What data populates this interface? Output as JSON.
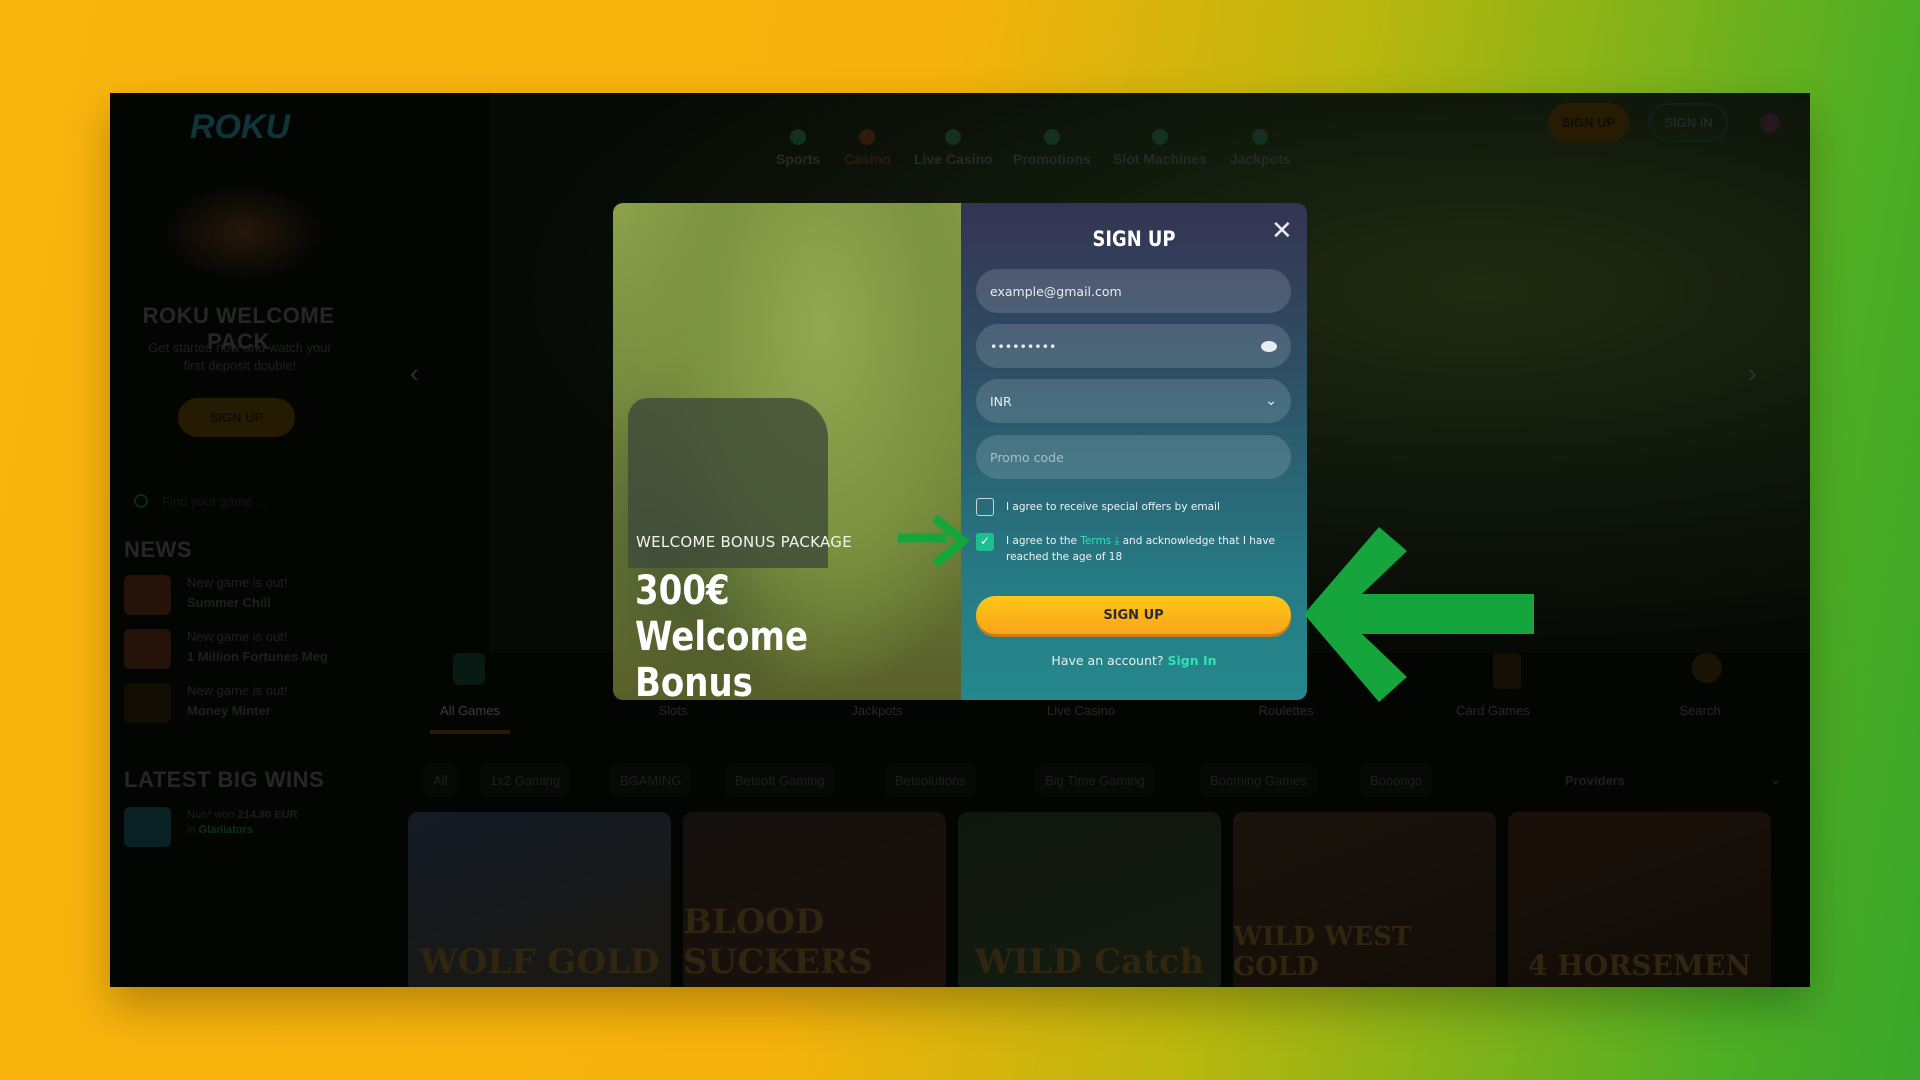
{
  "header": {
    "logo": "ROKU",
    "nav": [
      {
        "label": "Sports",
        "icon": "soccer-ball-icon"
      },
      {
        "label": "Casino",
        "icon": "slot-machine-icon",
        "active": true
      },
      {
        "label": "Live Casino",
        "icon": "dealer-icon"
      },
      {
        "label": "Promotions",
        "icon": "gift-icon"
      },
      {
        "label": "Slot Machines",
        "icon": "slot-icon"
      },
      {
        "label": "Jackpots",
        "icon": "jackpot-icon"
      }
    ],
    "signup": "SIGN UP",
    "signin": "SIGN IN",
    "language": "uk-flag-icon"
  },
  "sidebar": {
    "welcome_title": "ROKU WELCOME PACK",
    "welcome_text": "Get started now and watch your first deposit double!",
    "signup": "SIGN UP",
    "search_placeholder": "Find your game ...",
    "news_title": "NEWS",
    "news": [
      {
        "caption": "New game is out!",
        "game": "Summer Chill"
      },
      {
        "caption": "New game is out!",
        "game": "1 Million Fortunes Meg"
      },
      {
        "caption": "New game is out!",
        "game": "Money Minter"
      }
    ],
    "wins_title": "LATEST BIG WINS",
    "wins": [
      {
        "user": "Nun* won",
        "amount": "214.80 EUR",
        "in": "in",
        "game": "Gladiators"
      }
    ]
  },
  "categories": [
    "All Games",
    "Slots",
    "Jackpots",
    "Live Casino",
    "Roulettes",
    "Card Games",
    "Search"
  ],
  "providers": {
    "items": [
      "All",
      "1x2 Gaming",
      "BGAMING",
      "Betsoft Gaming",
      "Betsolutions",
      "Big Time Gaming",
      "Booming Games",
      "Booongo"
    ],
    "dropdown": "Providers"
  },
  "games": [
    "WOLF GOLD",
    "BLOOD SUCKERS",
    "WILD Catch",
    "WILD WEST GOLD",
    "4 HORSEMEN"
  ],
  "modal": {
    "promo_subtitle": "WELCOME BONUS PACKAGE",
    "promo_title": "300€ Welcome Bonus",
    "title": "SIGN UP",
    "email": "example@gmail.com",
    "password": "•••••••••",
    "currency": "INR",
    "promo_placeholder": "Promo code",
    "offers_label": "I agree to receive special offers by email",
    "offers_checked": false,
    "terms_pre": "I agree to the",
    "terms_link": "Terms",
    "terms_post": "and acknowledge that I have reached the age of 18",
    "terms_checked": true,
    "submit": "SIGN UP",
    "have_account": "Have an account?",
    "signin_link": "Sign In"
  },
  "colors": {
    "accent_yellow": "#f7b515",
    "link_teal": "#34e0b8",
    "arrow_green": "#16a53c"
  }
}
